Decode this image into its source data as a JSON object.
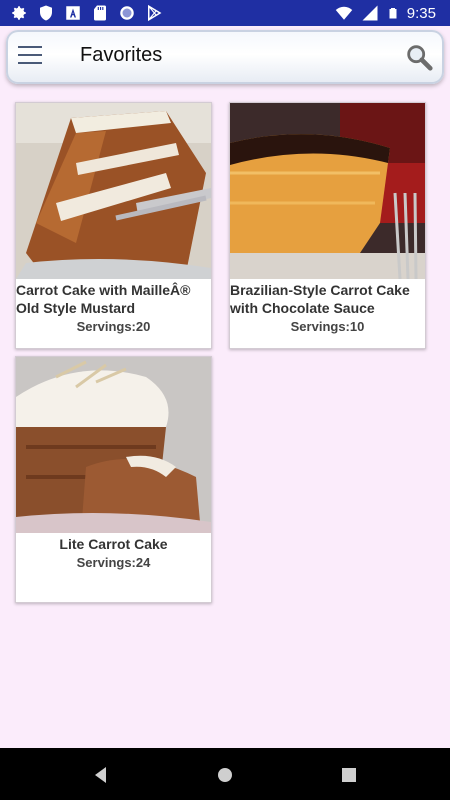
{
  "status_bar": {
    "time": "9:35",
    "left_icons": [
      "settings-icon",
      "shield-icon",
      "a-box-icon",
      "sd-card-icon",
      "circle-icon",
      "play-store-icon"
    ],
    "right_icons": [
      "wifi-icon",
      "signal-icon",
      "battery-icon"
    ]
  },
  "app_bar": {
    "title": "Favorites",
    "menu_icon": "hamburger-menu-icon",
    "search_icon": "search-icon"
  },
  "recipes": [
    {
      "name": "Carrot Cake with MailleÂ® Old Style Mustard",
      "servings": "Servings:20",
      "image": "carrot-cake-slice-photo"
    },
    {
      "name": "Brazilian-Style Carrot Cake with Chocolate Sauce",
      "servings": "Servings:10",
      "image": "brazilian-carrot-cake-photo"
    },
    {
      "name": "Lite Carrot Cake",
      "servings": "Servings:24",
      "image": "carrot-cupcake-photo"
    }
  ],
  "nav_bar": {
    "icons": [
      "back-icon",
      "home-icon",
      "recents-icon"
    ]
  }
}
